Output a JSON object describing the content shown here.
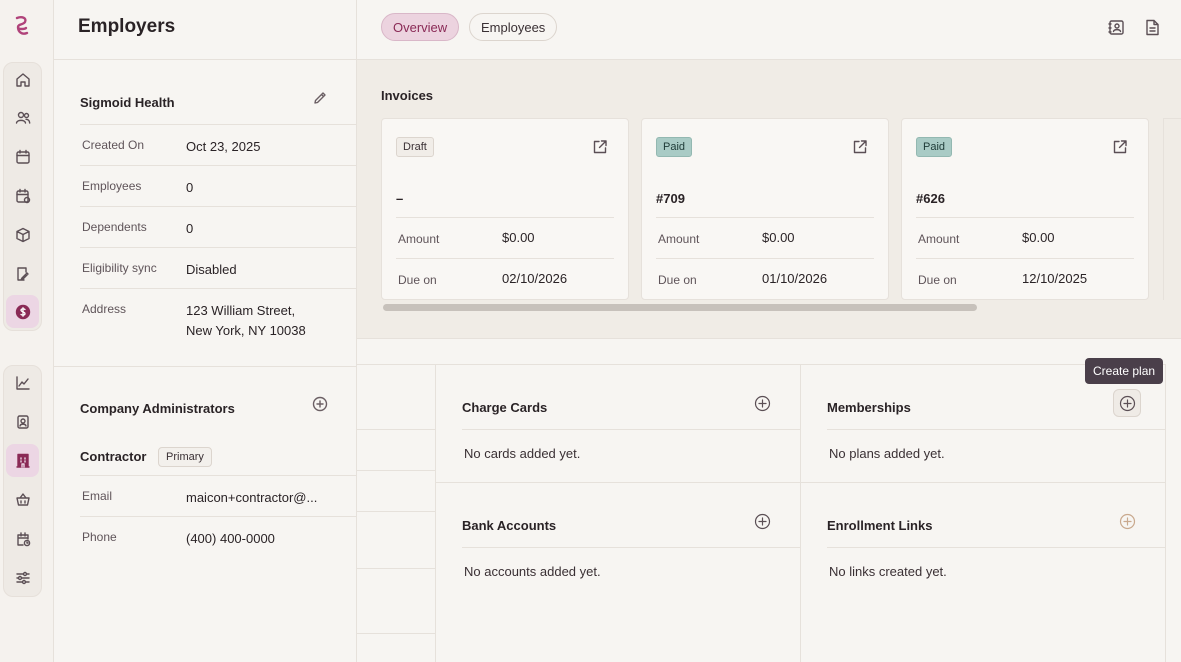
{
  "app": {
    "brand_color": "#b0437a"
  },
  "rail": {
    "group1": [
      "home-icon",
      "users-icon",
      "calendar-icon",
      "calendar-check-icon",
      "package-icon",
      "clipboard-icon",
      "dollar-icon"
    ],
    "group2": [
      "chart-icon",
      "id-badge-icon",
      "building-icon",
      "basket-icon",
      "calendar-clock-icon",
      "sliders-icon"
    ]
  },
  "page": {
    "title": "Employers"
  },
  "tabs": [
    {
      "label": "Overview",
      "active": true
    },
    {
      "label": "Employees",
      "active": false
    }
  ],
  "employer": {
    "name": "Sigmoid Health",
    "rows": [
      {
        "key": "Created On",
        "value": "Oct 23, 2025"
      },
      {
        "key": "Employees",
        "value": "0"
      },
      {
        "key": "Dependents",
        "value": "0"
      },
      {
        "key": "Eligibility sync",
        "value": "Disabled"
      },
      {
        "key": "Address",
        "value_line1": "123 William Street,",
        "value_line2": "New York, NY 10038"
      }
    ]
  },
  "admins": {
    "title": "Company Administrators",
    "contractor": {
      "name": "Contractor",
      "badge": "Primary"
    },
    "rows": [
      {
        "key": "Email",
        "value": "maicon+contractor@..."
      },
      {
        "key": "Phone",
        "value": "(400) 400-0000"
      }
    ]
  },
  "invoices": {
    "title": "Invoices",
    "amount_label": "Amount",
    "due_label": "Due on",
    "cards": [
      {
        "status": "Draft",
        "number": "–",
        "amount": "$0.00",
        "due": "02/10/2026"
      },
      {
        "status": "Paid",
        "number": "#709",
        "amount": "$0.00",
        "due": "01/10/2026"
      },
      {
        "status": "Paid",
        "number": "#626",
        "amount": "$0.00",
        "due": "12/10/2025"
      }
    ]
  },
  "charge_cards": {
    "title": "Charge Cards",
    "empty": "No cards added yet."
  },
  "memberships": {
    "title": "Memberships",
    "empty": "No plans added yet.",
    "tooltip": "Create plan"
  },
  "bank_accounts": {
    "title": "Bank Accounts",
    "empty": "No accounts added yet."
  },
  "enrollment_links": {
    "title": "Enrollment Links",
    "empty": "No links created yet."
  }
}
